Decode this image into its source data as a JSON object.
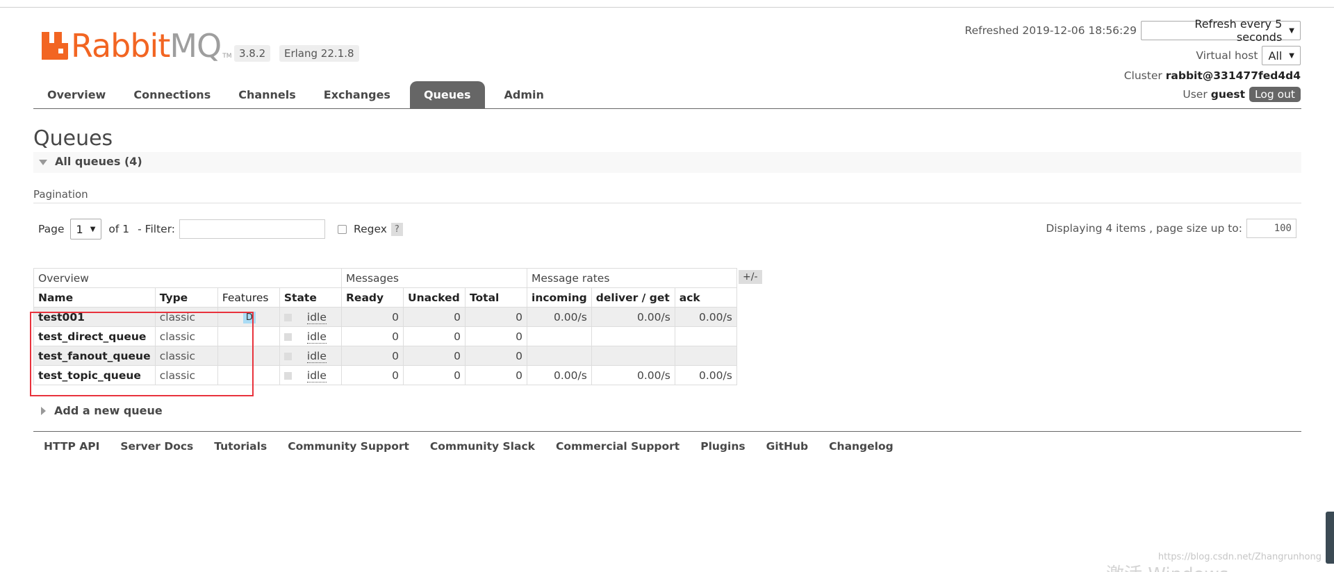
{
  "app": {
    "logo_rabbit": "Rabbit",
    "logo_mq": "MQ",
    "logo_tm": "TM",
    "version": "3.8.2",
    "erlang": "Erlang 22.1.8"
  },
  "status": {
    "refreshed": "Refreshed 2019-12-06 18:56:29",
    "refresh_select": "Refresh every 5 seconds",
    "vhost_label": "Virtual host",
    "vhost_value": "All",
    "cluster_label": "Cluster",
    "cluster_value": "rabbit@331477fed4d4",
    "user_label": "User",
    "user_value": "guest",
    "logout": "Log out"
  },
  "nav": {
    "tabs": [
      "Overview",
      "Connections",
      "Channels",
      "Exchanges",
      "Queues",
      "Admin"
    ],
    "active": "Queues"
  },
  "page": {
    "title": "Queues",
    "section": "All queues (4)",
    "pagination_label": "Pagination",
    "page_label": "Page",
    "page_value": "1",
    "of_label": "of 1",
    "filter_label": "- Filter:",
    "filter_value": "",
    "regex_label": "Regex",
    "help": "?",
    "displaying": "Displaying 4 items , page size up to:",
    "page_size": "100"
  },
  "table": {
    "groups": [
      "Overview",
      "Messages",
      "Message rates"
    ],
    "headers": [
      "Name",
      "Type",
      "Features",
      "State",
      "Ready",
      "Unacked",
      "Total",
      "incoming",
      "deliver / get",
      "ack"
    ],
    "plus_minus": "+/-",
    "rows": [
      {
        "name": "test001",
        "type": "classic",
        "features": "D",
        "state": "idle",
        "ready": "0",
        "unacked": "0",
        "total": "0",
        "incoming": "0.00/s",
        "deliver": "0.00/s",
        "ack": "0.00/s"
      },
      {
        "name": "test_direct_queue",
        "type": "classic",
        "features": "",
        "state": "idle",
        "ready": "0",
        "unacked": "0",
        "total": "0",
        "incoming": "",
        "deliver": "",
        "ack": ""
      },
      {
        "name": "test_fanout_queue",
        "type": "classic",
        "features": "",
        "state": "idle",
        "ready": "0",
        "unacked": "0",
        "total": "0",
        "incoming": "",
        "deliver": "",
        "ack": ""
      },
      {
        "name": "test_topic_queue",
        "type": "classic",
        "features": "",
        "state": "idle",
        "ready": "0",
        "unacked": "0",
        "total": "0",
        "incoming": "0.00/s",
        "deliver": "0.00/s",
        "ack": "0.00/s"
      }
    ]
  },
  "add_queue": "Add a new queue",
  "footer": [
    "HTTP API",
    "Server Docs",
    "Tutorials",
    "Community Support",
    "Community Slack",
    "Commercial Support",
    "Plugins",
    "GitHub",
    "Changelog"
  ],
  "watermark": "https://blog.csdn.net/Zhangrunhong",
  "watermark2": "激活 Windows",
  "colors": {
    "brand": "#f26522",
    "tab_active": "#666666",
    "highlight_box": "#e8323c",
    "feature_badge": "#aadcf5"
  },
  "icons": {
    "section_toggle": "triangle-down-icon",
    "add_queue_toggle": "triangle-right-icon",
    "dropdown": "chevron-down-icon"
  }
}
